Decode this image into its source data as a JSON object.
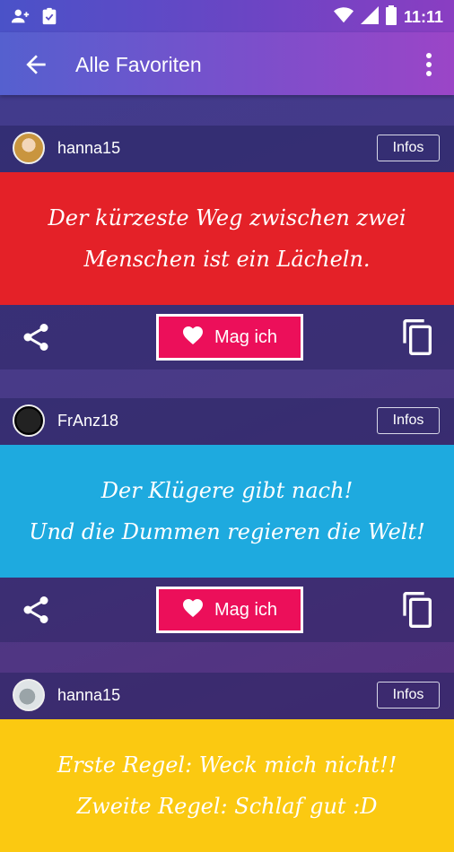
{
  "status_bar": {
    "time": "11:11",
    "icons": [
      "person-add-icon",
      "clipboard-check-icon",
      "wifi-icon",
      "signal-icon",
      "battery-icon"
    ]
  },
  "app_bar": {
    "title": "Alle Favoriten",
    "back_icon": "arrow-back-icon",
    "menu_icon": "more-vert-icon"
  },
  "cards": [
    {
      "username": "hanna15",
      "infos_label": "Infos",
      "quote": "Der kürzeste Weg zwischen zwei\nMenschen ist ein Lächeln.",
      "quote_color": "#e42128",
      "like_label": "Mag ich"
    },
    {
      "username": "FrAnz18",
      "infos_label": "Infos",
      "quote": "Der Klügere gibt nach!\nUnd die Dummen regieren die Welt!",
      "quote_color": "#1eaadf",
      "like_label": "Mag ich"
    },
    {
      "username": "hanna15",
      "infos_label": "Infos",
      "quote": "Erste Regel: Weck mich nicht!!\nZweite Regel: Schlaf gut :D",
      "quote_color": "#fbc911",
      "like_label": "Mag ich"
    }
  ],
  "colors": {
    "like_button": "#ec0f5a",
    "app_bar_start": "#5560cf",
    "app_bar_end": "#9b45c7"
  }
}
